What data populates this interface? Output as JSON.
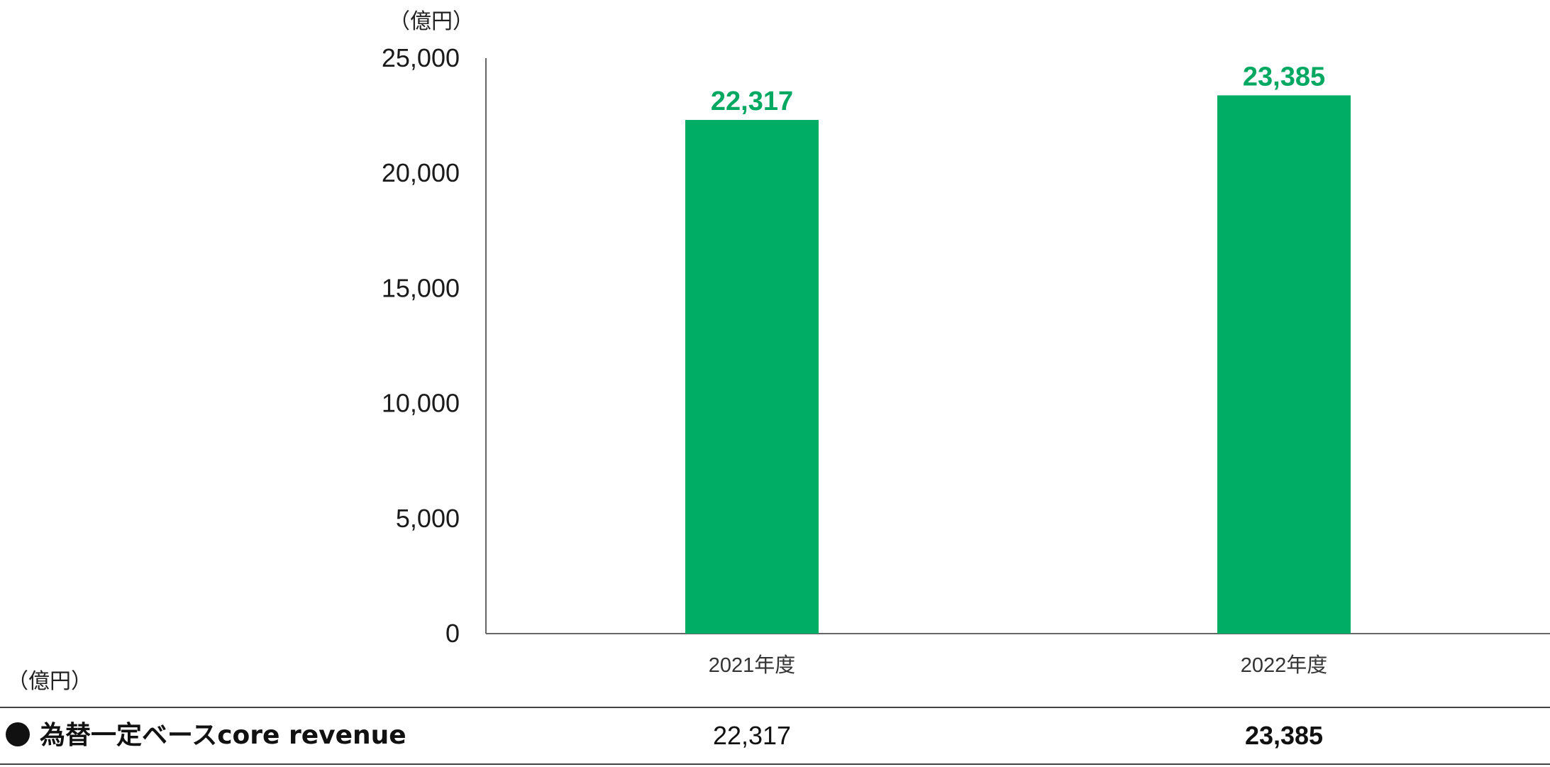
{
  "chart_data": {
    "type": "bar",
    "unit_label": "（億円）",
    "categories": [
      "2021年度",
      "2022年度"
    ],
    "values": [
      22317,
      23385
    ],
    "value_labels": [
      "22,317",
      "23,385"
    ],
    "ylim": [
      0,
      25000
    ],
    "yticks": [
      0,
      5000,
      10000,
      15000,
      20000,
      25000
    ],
    "ytick_labels": [
      "0",
      "5,000",
      "10,000",
      "15,000",
      "20,000",
      "25,000"
    ],
    "grid": false,
    "legend": "none",
    "bar_color": "#00AD65",
    "label_color": "#00A862"
  },
  "table": {
    "unit_label": "（億円）",
    "row_label": "為替一定ベースcore revenue",
    "values": [
      "22,317",
      "23,385"
    ]
  }
}
